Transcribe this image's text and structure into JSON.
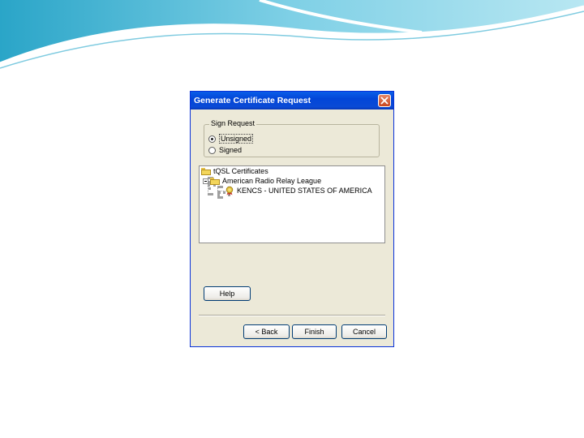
{
  "dialog": {
    "title": "Generate Certificate Request",
    "sign_group": {
      "legend": "Sign Request",
      "options": [
        {
          "label": "Unsigned",
          "selected": true
        },
        {
          "label": "Signed",
          "selected": false
        }
      ]
    },
    "tree": {
      "root": "tQSL Certificates",
      "issuer": "American Radio Relay League",
      "callsign": "KENCS - UNITED STATES OF AMERICA"
    },
    "buttons": {
      "help": "Help",
      "back": "< Back",
      "finish": "Finish",
      "cancel": "Cancel"
    }
  },
  "icons": {
    "close": "close-x-icon",
    "folder": "folder-icon",
    "certificate": "certificate-ribbon-icon",
    "expander": "tree-expander-minus-icon"
  },
  "colors": {
    "titlebar": "#0a5ee8",
    "dialog_bg": "#ece9d8",
    "close_button": "#c9461e"
  }
}
